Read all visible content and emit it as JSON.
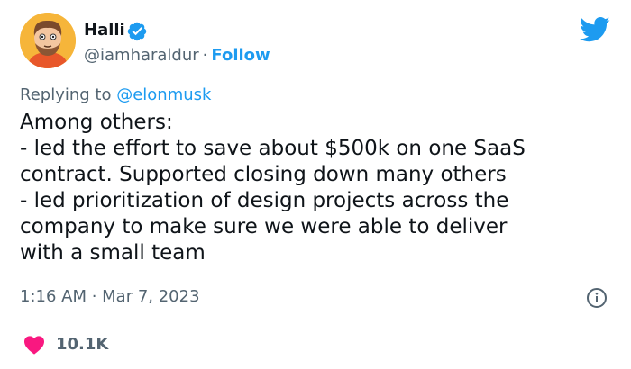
{
  "author": {
    "display_name": "Halli",
    "handle": "@iamharaldur",
    "separator": "·",
    "follow_label": "Follow",
    "verified": true
  },
  "reply": {
    "prefix": "Replying to",
    "mention": "@elonmusk"
  },
  "tweet": {
    "lines": [
      "Among others:",
      "- led the effort to save about $500k on one SaaS",
      "contract. Supported closing down many others",
      "- led prioritization of design projects across the",
      "company to make sure we were able to deliver",
      "with a small team"
    ]
  },
  "meta": {
    "timestamp": "1:16 AM · Mar 7, 2023"
  },
  "engagement": {
    "likes": "10.1K"
  },
  "colors": {
    "accent": "#1d9bf0",
    "text": "#0f1419",
    "muted": "#536471",
    "heart": "#f91880",
    "divider": "#cfd9de"
  },
  "icons": {
    "verified": "verified-badge-icon",
    "brand": "twitter-bird-icon",
    "info": "info-icon",
    "like": "heart-icon"
  }
}
